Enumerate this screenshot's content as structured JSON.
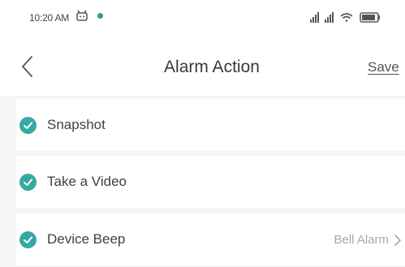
{
  "status_bar": {
    "time": "10:20 AM",
    "icons": [
      "notification-icon",
      "status-dot-icon",
      "signal-icon",
      "signal-icon",
      "wifi-icon",
      "battery-icon"
    ],
    "dot_color": "#3c9c63"
  },
  "nav": {
    "back_icon": "chevron-left-icon",
    "title": "Alarm Action",
    "save_label": "Save"
  },
  "items": [
    {
      "label": "Snapshot",
      "checked": true,
      "value": ""
    },
    {
      "label": "Take a Video",
      "checked": true,
      "value": ""
    },
    {
      "label": "Device Beep",
      "checked": true,
      "value": "Bell Alarm"
    }
  ],
  "colors": {
    "accent": "#35aaa3",
    "list_background": "#f6f6f6",
    "text": "#404040",
    "secondary_text": "#a8a8a8"
  }
}
